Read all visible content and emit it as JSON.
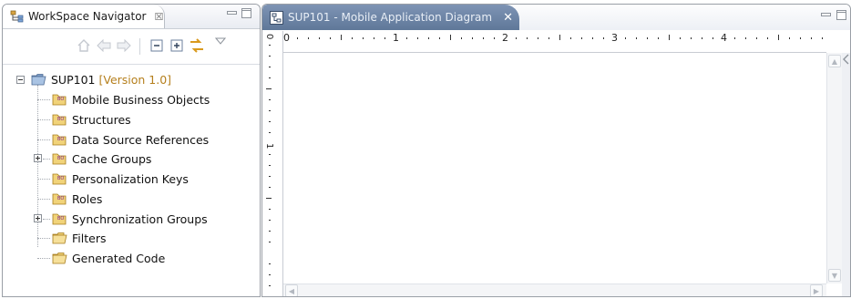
{
  "navigator": {
    "title": "WorkSpace Navigator",
    "tab_close_glyph": "☒",
    "minimize_glyph": "▭",
    "maximize_glyph": "□",
    "toolbar_icons": [
      "home-icon",
      "back-arrow-icon",
      "forward-arrow-icon",
      "collapse-all-icon",
      "expand-all-icon",
      "link-with-editor-icon",
      "view-menu-icon"
    ]
  },
  "tree": {
    "root": {
      "label": "SUP101",
      "version": "[Version 1.0]"
    },
    "items": [
      {
        "label": "Mobile Business Objects",
        "expandable": false
      },
      {
        "label": "Structures",
        "expandable": false
      },
      {
        "label": "Data Source References",
        "expandable": false
      },
      {
        "label": "Cache Groups",
        "expandable": true
      },
      {
        "label": "Personalization Keys",
        "expandable": false
      },
      {
        "label": "Roles",
        "expandable": false
      },
      {
        "label": "Synchronization Groups",
        "expandable": true
      },
      {
        "label": "Filters",
        "expandable": false
      },
      {
        "label": "Generated Code",
        "expandable": false
      }
    ]
  },
  "editor": {
    "tab_title": "SUP101 - Mobile Application Diagram",
    "tab_close_glyph": "✕",
    "ruler_h_labels": [
      "0",
      "1",
      "2",
      "3",
      "4"
    ],
    "ruler_v_labels": [
      "0",
      "1"
    ]
  },
  "colors": {
    "version": "#b57f1c",
    "editor_tab": "#6d84a6",
    "folder": "#e8c55a"
  }
}
